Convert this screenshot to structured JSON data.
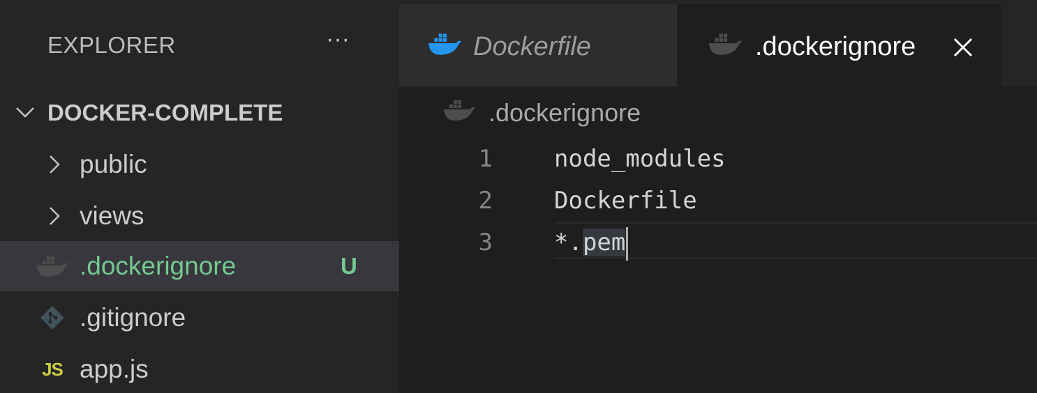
{
  "sidebar": {
    "title": "EXPLORER",
    "more_label": "···",
    "folder": "DOCKER-COMPLETE",
    "items": [
      {
        "label": "public",
        "type": "folder"
      },
      {
        "label": "views",
        "type": "folder"
      },
      {
        "label": ".dockerignore",
        "type": "file",
        "icon": "docker-icon",
        "status": "U"
      },
      {
        "label": ".gitignore",
        "type": "file",
        "icon": "git-icon"
      },
      {
        "label": "app.js",
        "type": "file",
        "icon": "js-icon",
        "icon_text": "JS"
      }
    ]
  },
  "tabs": [
    {
      "label": "Dockerfile",
      "icon": "docker-icon",
      "active": false,
      "preview": true
    },
    {
      "label": ".dockerignore",
      "icon": "docker-icon",
      "active": true
    }
  ],
  "breadcrumb": {
    "file": ".dockerignore"
  },
  "editor": {
    "lines": [
      {
        "number": "1",
        "text": "node_modules"
      },
      {
        "number": "2",
        "text": "Dockerfile"
      },
      {
        "number": "3",
        "text_prefix": "*.",
        "text_highlight": "pem"
      }
    ]
  },
  "colors": {
    "background": "#1e1e1e",
    "sidebar": "#252526",
    "selected_row": "#37373d",
    "untracked_green": "#73c991",
    "docker_blue": "#2496ed",
    "js_yellow": "#cbcb41"
  }
}
